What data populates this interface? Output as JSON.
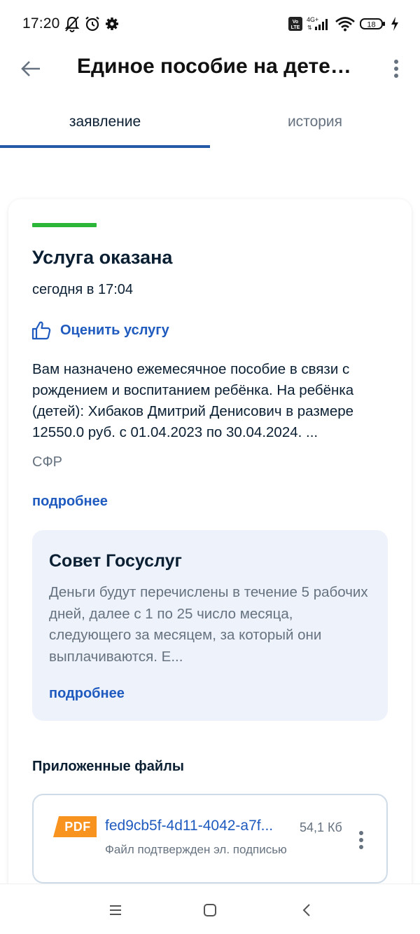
{
  "status_bar": {
    "time": "17:20",
    "network": "4G+",
    "volte": "Vo LTE",
    "battery": "18"
  },
  "header": {
    "title": "Единое пособие на детей…"
  },
  "tabs": [
    {
      "label": "заявление",
      "active": true
    },
    {
      "label": "история",
      "active": false
    }
  ],
  "card": {
    "status_color": "#2ab738",
    "title": "Услуга оказана",
    "date": "сегодня в 17:04",
    "rate_label": "Оценить услугу",
    "description": "Вам назначено ежемесячное пособие в связи с рождением и воспитанием ребёнка. На ребёнка (детей): Хибаков Дмитрий Денисович в размере 12550.0 руб. с 01.04.2023 по 30.04.2024. ...",
    "organization": "СФР",
    "more_label": "подробнее"
  },
  "advice": {
    "title": "Совет Госуслуг",
    "text": "Деньги будут перечислены в течение 5 рабочих дней, далее с 1 по 25 число месяца, следующего за месяцем, за который они выплачиваются. Е...",
    "more_label": "подробнее"
  },
  "files": {
    "title": "Приложенные файлы",
    "items": [
      {
        "badge": "PDF",
        "name": "fed9cb5f-4d11-4042-a7f...",
        "size": "54,1 Кб",
        "note": "Файл подтвержден эл. подписью"
      }
    ]
  },
  "colors": {
    "accent": "#1f5bbf",
    "success": "#2ab738",
    "pdf_badge": "#f7931e",
    "advice_bg": "#edf2fb"
  }
}
